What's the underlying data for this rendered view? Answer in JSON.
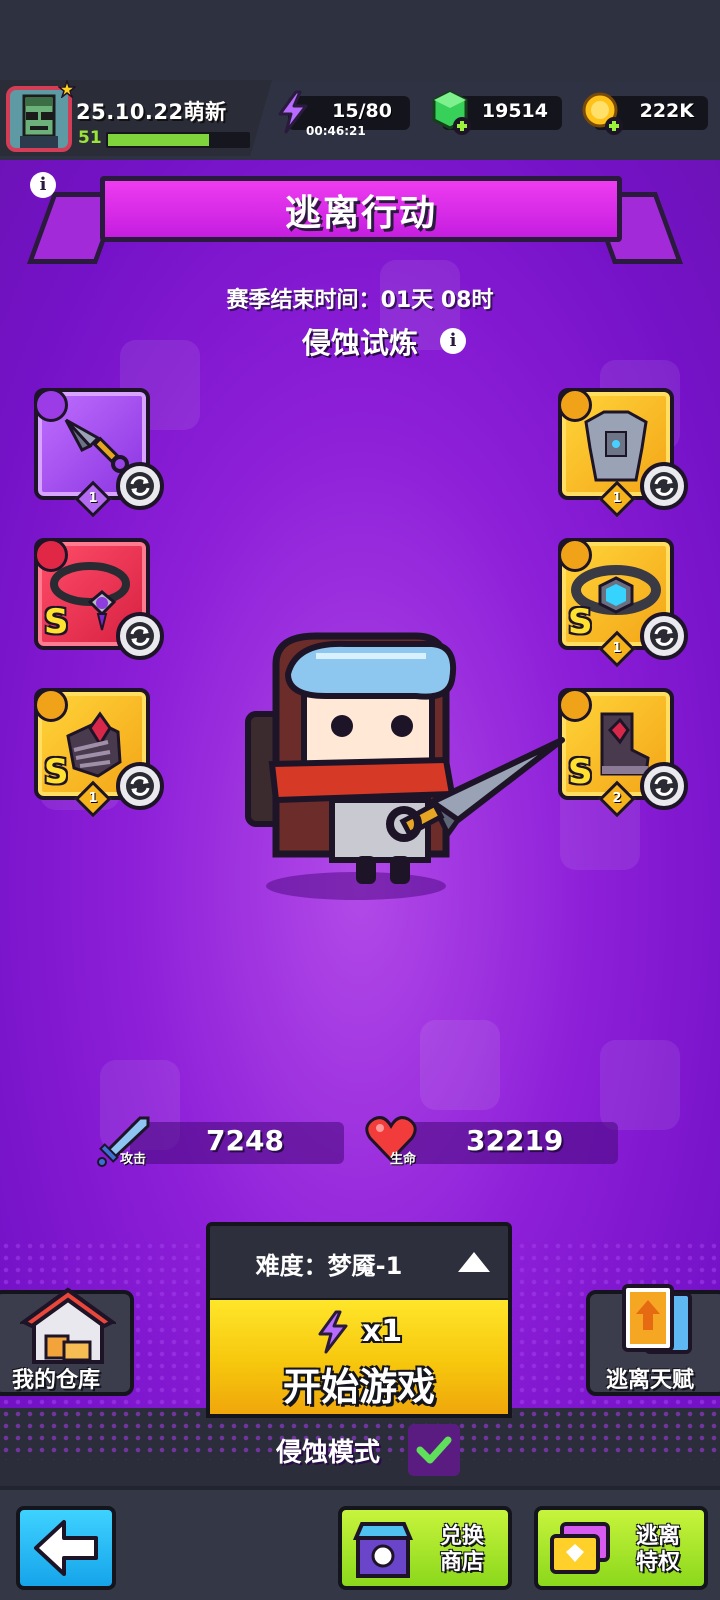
{
  "player": {
    "name": "25.10.22萌新",
    "level": "51",
    "xp_fraction": 0.72
  },
  "resources": {
    "energy": "15/80",
    "energy_timer": "00:46:21",
    "gems": "19514",
    "coins": "222K"
  },
  "event": {
    "title": "逃离行动",
    "season_label": "赛季结束时间：",
    "season_value": "01天 08时",
    "trial_label": "侵蚀试炼"
  },
  "equipment": {
    "weapon": {
      "level": "1",
      "rarity": "purple"
    },
    "armor": {
      "level": "1",
      "rarity": "gold"
    },
    "necklace": {
      "grade": "S",
      "rarity": "red"
    },
    "belt": {
      "grade": "S",
      "level": "1",
      "rarity": "gold"
    },
    "gloves": {
      "grade": "S",
      "level": "1",
      "rarity": "gold"
    },
    "boots": {
      "grade": "S",
      "level": "2",
      "rarity": "gold"
    }
  },
  "stats": {
    "attack_tag": "攻击",
    "attack": "7248",
    "hp_tag": "生命",
    "hp": "32219"
  },
  "difficulty": {
    "label": "难度：梦魇-1"
  },
  "start": {
    "cost": "x1",
    "label": "开始游戏"
  },
  "side": {
    "warehouse": "我的仓库",
    "talent": "逃离天赋"
  },
  "mode": {
    "label": "侵蚀模式",
    "checked": true
  },
  "nav": {
    "shop": "兑换\n商店",
    "shop_line1": "兑换",
    "shop_line2": "商店",
    "privilege_line1": "逃离",
    "privilege_line2": "特权"
  },
  "colors": {
    "accent_purple": "#8d1fd8",
    "banner_magenta": "#e632ec",
    "start_yellow": "#f6c70d",
    "nav_green": "#9be025",
    "back_blue": "#26baf3"
  }
}
